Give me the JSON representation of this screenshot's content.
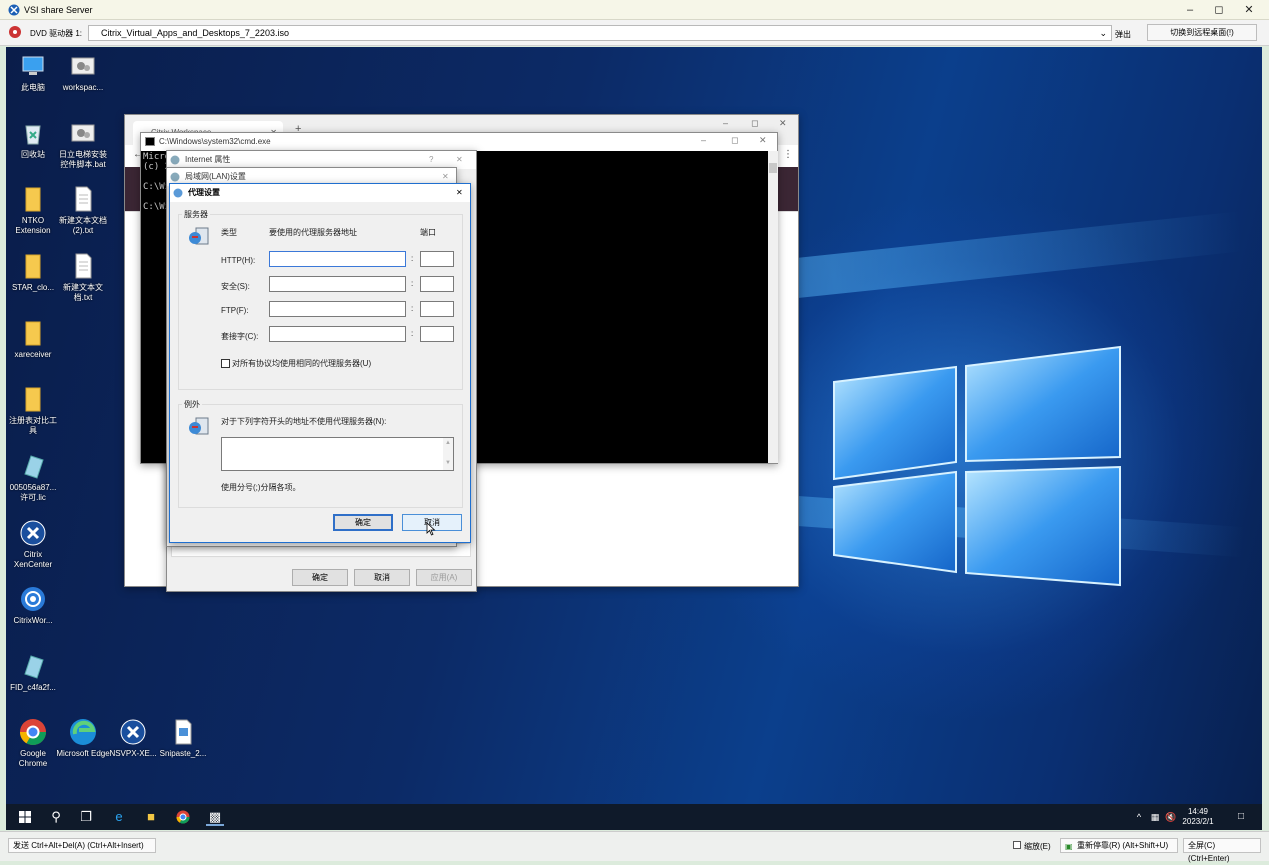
{
  "app": {
    "title": "VSI share Server",
    "dvd_label": "DVD 驱动器 1:",
    "dvd_value": "Citrix_Virtual_Apps_and_Desktops_7_2203.iso",
    "eject_label": "弹出",
    "switch_label": "切换到远程桌面(!)"
  },
  "desktop_icons": [
    {
      "label": "此电脑",
      "icon": "computer-icon"
    },
    {
      "label": "workspac...",
      "icon": "settings-file-icon"
    },
    {
      "label": "回收站",
      "icon": "recycle-bin-icon"
    },
    {
      "label": "日立电梯安装控件脚本.bat",
      "icon": "batch-file-icon"
    },
    {
      "label": "NTKO Extension",
      "icon": "folder-icon"
    },
    {
      "label": "新建文本文档 (2).txt",
      "icon": "text-file-icon"
    },
    {
      "label": "STAR_clo...",
      "icon": "folder-icon"
    },
    {
      "label": "新建文本文档.txt",
      "icon": "text-file-icon"
    },
    {
      "label": "xareceiver",
      "icon": "folder-icon"
    },
    {
      "label": "注册表对比工具",
      "icon": "folder-icon"
    },
    {
      "label": "005056a87... 许可.lic",
      "icon": "license-file-icon"
    },
    {
      "label": "Citrix XenCenter",
      "icon": "xencenter-icon"
    },
    {
      "label": "CitrixWor...",
      "icon": "citrix-workspace-icon"
    },
    {
      "label": "FID_c4fa2f...",
      "icon": "license-file-icon"
    },
    {
      "label": "Google Chrome",
      "icon": "chrome-icon"
    },
    {
      "label": "Microsoft Edge",
      "icon": "edge-icon"
    },
    {
      "label": "NSVPX-XE...",
      "icon": "xencenter-icon"
    },
    {
      "label": "Snipaste_2...",
      "icon": "image-file-icon"
    }
  ],
  "browser": {
    "tab_title": "Citrix Workspace",
    "new_tab": "+"
  },
  "cmd": {
    "title": "C:\\Windows\\system32\\cmd.exe",
    "lines": [
      "Micro",
      "(c) 2",
      "C:\\Wi",
      "C:\\Wi"
    ]
  },
  "internet_props": {
    "title": "Internet 属性",
    "ok": "确定",
    "cancel": "取消",
    "apply": "应用(A)",
    "help": "?"
  },
  "lan": {
    "title": "局域网(LAN)设置"
  },
  "proxy": {
    "title": "代理设置",
    "servers_group": "服务器",
    "col_type": "类型",
    "col_address": "要使用的代理服务器地址",
    "col_port": "端口",
    "rows": [
      {
        "label": "HTTP(H):",
        "address": "",
        "port": ""
      },
      {
        "label": "安全(S):",
        "address": "",
        "port": ""
      },
      {
        "label": "FTP(F):",
        "address": "",
        "port": ""
      },
      {
        "label": "套接字(C):",
        "address": "",
        "port": ""
      }
    ],
    "same_proxy_label": "对所有协议均使用相同的代理服务器(U)",
    "same_proxy_checked": false,
    "exceptions_group": "例外",
    "exceptions_label": "对于下列字符开头的地址不使用代理服务器(N):",
    "exceptions_value": "",
    "exceptions_hint": "使用分号(;)分隔各项。",
    "ok": "确定",
    "cancel": "取消"
  },
  "taskbar": {
    "time": "14:49",
    "date": "2023/2/1"
  },
  "statusbar": {
    "send_cad": "发送 Ctrl+Alt+Del(A) (Ctrl+Alt+Insert)",
    "scale_label": "缩放(E)",
    "scale_checked": false,
    "reconnect": "重新停靠(R) (Alt+Shift+U)",
    "fullscreen": "全屏(C)(Ctrl+Enter)"
  }
}
